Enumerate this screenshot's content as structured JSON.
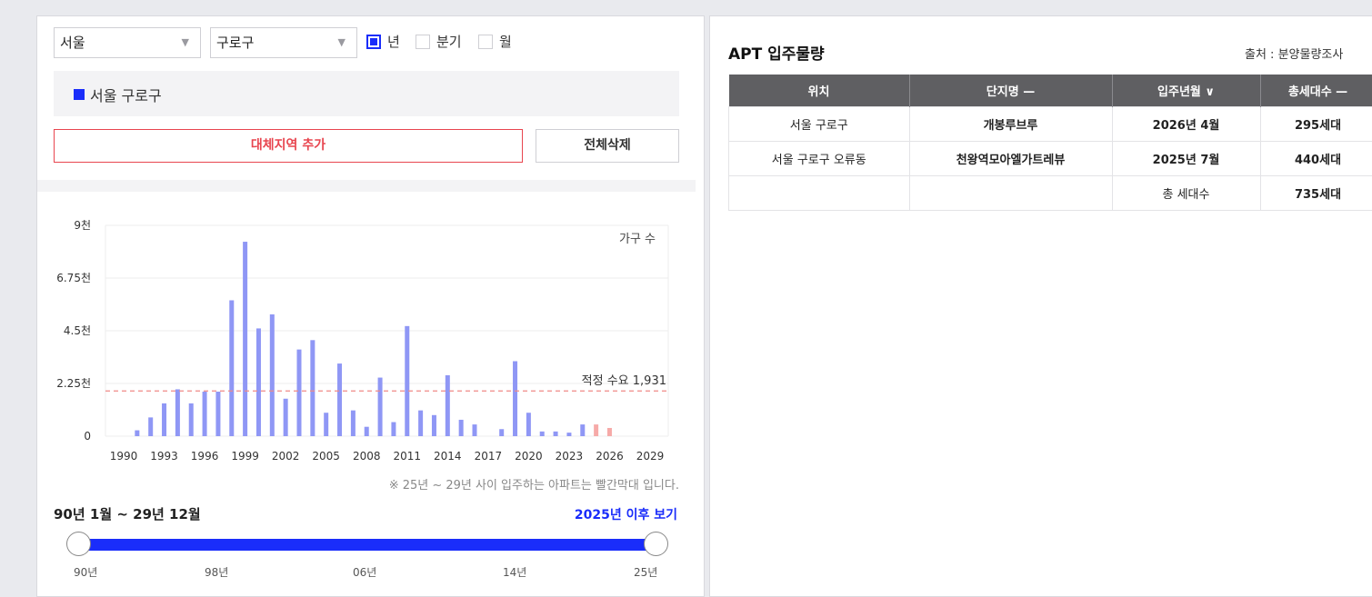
{
  "filters": {
    "city": "서울",
    "district": "구로구",
    "period_options": [
      {
        "label": "년",
        "checked": true
      },
      {
        "label": "분기",
        "checked": false
      },
      {
        "label": "월",
        "checked": false
      }
    ]
  },
  "selected_region": "서울 구로구",
  "buttons": {
    "add_alt_region": "대체지역 추가",
    "delete_all": "전체삭제"
  },
  "chart_data": {
    "type": "bar",
    "series_label": "가구 수",
    "y_tick_labels": [
      "0",
      "2.25천",
      "4.5천",
      "6.75천",
      "9천"
    ],
    "y_ticks": [
      0,
      2250,
      4500,
      6750,
      9000
    ],
    "ylim": [
      0,
      9000
    ],
    "x_tick_labels": [
      "1990",
      "1993",
      "1996",
      "1999",
      "2002",
      "2005",
      "2008",
      "2011",
      "2014",
      "2017",
      "2020",
      "2023",
      "2026",
      "2029"
    ],
    "years": [
      1990,
      1991,
      1992,
      1993,
      1994,
      1995,
      1996,
      1997,
      1998,
      1999,
      2000,
      2001,
      2002,
      2003,
      2004,
      2005,
      2006,
      2007,
      2008,
      2009,
      2010,
      2011,
      2012,
      2013,
      2014,
      2015,
      2016,
      2017,
      2018,
      2019,
      2020,
      2021,
      2022,
      2023,
      2024,
      2025,
      2026,
      2027,
      2028,
      2029
    ],
    "values": [
      0,
      250,
      800,
      1400,
      2000,
      1400,
      1900,
      1900,
      5800,
      8300,
      4600,
      5200,
      1600,
      3700,
      4100,
      1000,
      3100,
      1100,
      400,
      2500,
      600,
      4700,
      1100,
      900,
      2600,
      700,
      500,
      0,
      300,
      3200,
      1000,
      200,
      200,
      150,
      500,
      500,
      350,
      0,
      0,
      0
    ],
    "highlight_years_from": 2025,
    "colors": {
      "normal": "#8f97f5",
      "future": "#f6aaa8"
    },
    "reference": {
      "label": "적정 수요 1,931",
      "value": 1931,
      "color": "#f08a86"
    }
  },
  "note": "※ 25년 ~ 29년 사이 입주하는 아파트는 빨간막대 입니다.",
  "range": {
    "label": "90년 1월 ~ 29년 12월",
    "after_link": "2025년 이후 보기",
    "slider_labels": [
      "90년",
      "98년",
      "06년",
      "14년",
      "25년"
    ]
  },
  "apt": {
    "title": "APT 입주물량",
    "source": "출처 : 분양물량조사",
    "headers": [
      "위치",
      "단지명 —",
      "입주년월 ∨",
      "총세대수 —"
    ],
    "rows": [
      [
        "서울 구로구",
        "개봉루브루",
        "2026년 4월",
        "295세대"
      ],
      [
        "서울 구로구 오류동",
        "천왕역모아엘가트레뷰",
        "2025년 7월",
        "440세대"
      ],
      [
        "",
        "",
        "총 세대수",
        "735세대"
      ]
    ]
  }
}
